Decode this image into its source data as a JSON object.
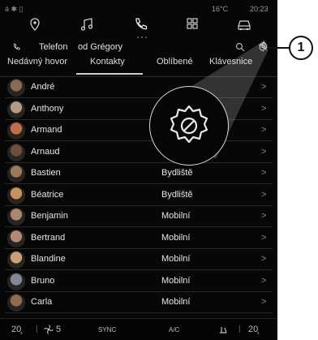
{
  "status": {
    "left_icons": "á  ✱  ▯",
    "temperature": "16°C",
    "time": "20:23"
  },
  "nav_icons": [
    "map-pin-icon",
    "music-note-icon",
    "phone-icon",
    "apps-grid-icon",
    "car-icon"
  ],
  "header": {
    "title": "Telefon",
    "device": "od Grégory"
  },
  "tabs": [
    {
      "label": "Nedávný hovor",
      "active": false
    },
    {
      "label": "Kontakty",
      "active": true
    },
    {
      "label": "Oblíbené",
      "active": false
    },
    {
      "label": "Klávesnice",
      "active": false
    }
  ],
  "contacts": [
    {
      "name": "André",
      "type": "",
      "avatar_color": "#8a6a55"
    },
    {
      "name": "Anthony",
      "type": "",
      "avatar_color": "#b59a86"
    },
    {
      "name": "Armand",
      "type": "",
      "avatar_color": "#c06f4c"
    },
    {
      "name": "Arnaud",
      "type": "",
      "avatar_color": "#6e4f3e"
    },
    {
      "name": "Bastien",
      "type": "Bydliště",
      "avatar_color": "#9a7a5a"
    },
    {
      "name": "Béatrice",
      "type": "Bydliště",
      "avatar_color": "#c8925f"
    },
    {
      "name": "Benjamin",
      "type": "Mobilní",
      "avatar_color": "#a9866e"
    },
    {
      "name": "Bertrand",
      "type": "Mobilní",
      "avatar_color": "#b48876"
    },
    {
      "name": "Blandine",
      "type": "Mobilní",
      "avatar_color": "#c9a07a"
    },
    {
      "name": "Bruno",
      "type": "Mobilní",
      "avatar_color": "#7f8a96"
    },
    {
      "name": "Carla",
      "type": "Mobilní",
      "avatar_color": "#8f6c50"
    }
  ],
  "chevron": ">",
  "bottom_bar": {
    "temp_left": "20̧",
    "fan_level": "5",
    "sync": "SYNC",
    "ac": "A/C",
    "temp_right": "20̧"
  },
  "callout_number": "1"
}
